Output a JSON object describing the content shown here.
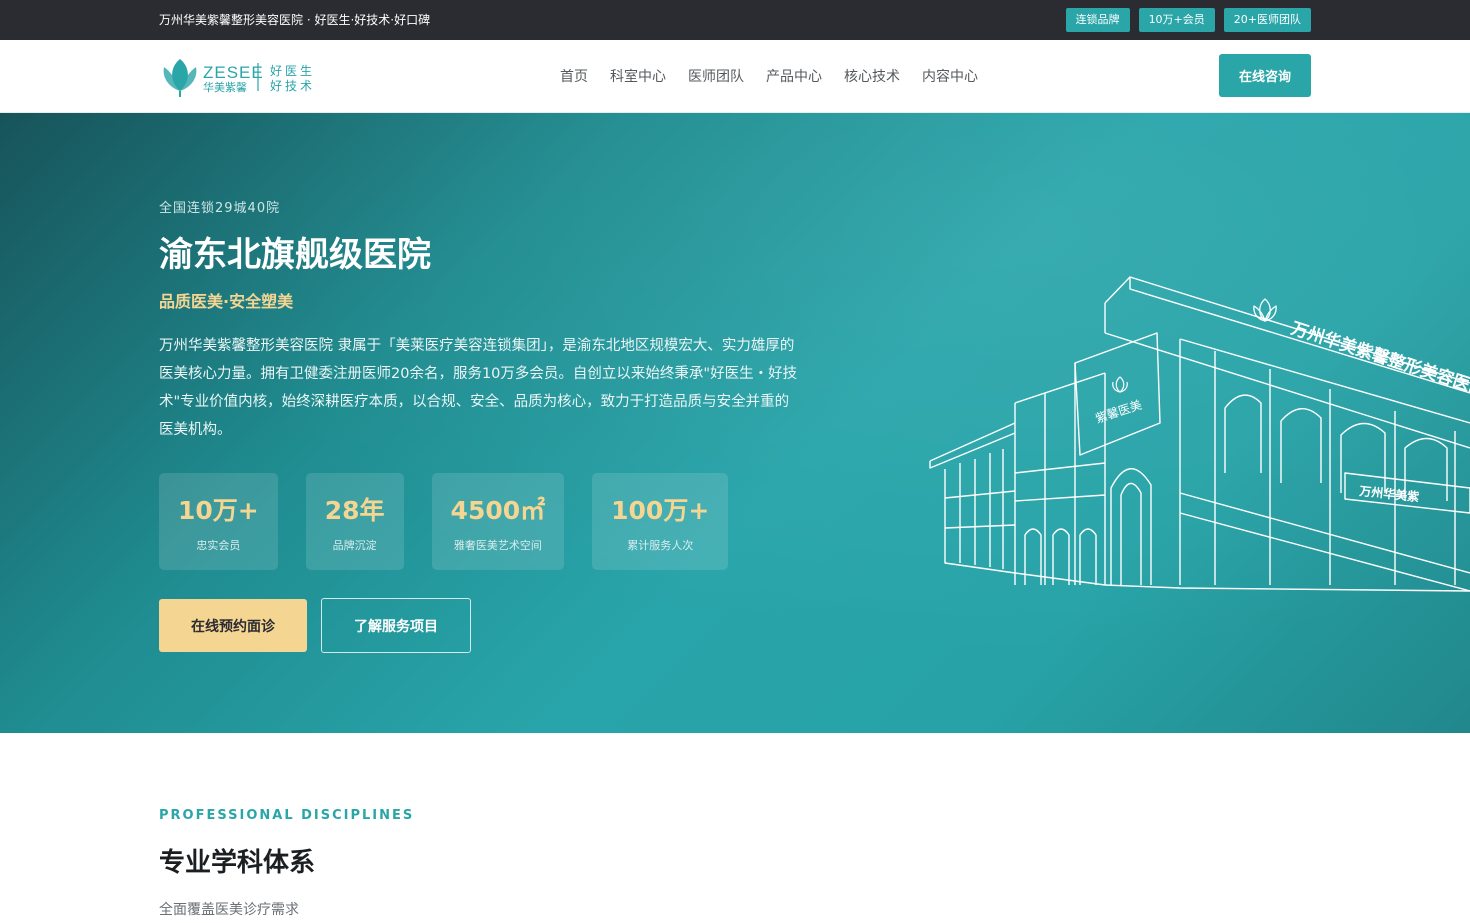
{
  "topbar": {
    "text": "万州华美紫馨整形美容医院 · 好医生·好技术·好口碑",
    "badges": [
      "连锁品牌",
      "10万+会员",
      "20+医师团队"
    ]
  },
  "logo": {
    "brand_en": "ZESEE",
    "brand_cn": "华美紫馨",
    "motto_line1": "好医生",
    "motto_line2": "好技术"
  },
  "nav": {
    "items": [
      "首页",
      "科室中心",
      "医师团队",
      "产品中心",
      "核心技术",
      "内容中心"
    ],
    "cta": "在线咨询"
  },
  "hero": {
    "kicker": "全国连锁29城40院",
    "title": "渝东北旗舰级医院",
    "slogan": "品质医美·安全塑美",
    "description": "万州华美紫馨整形美容医院 隶属于「美莱医疗美容连锁集团」，是渝东北地区规模宏大、实力雄厚的医美核心力量。拥有卫健委注册医师20余名，服务10万多会员。自创立以来始终秉承\"好医生・好技术\"专业价值内核，始终深耕医疗本质，以合规、安全、品质为核心，致力于打造品质与安全并重的医美机构。",
    "stats": [
      {
        "value": "10万+",
        "label": "忠实会员"
      },
      {
        "value": "28年",
        "label": "品牌沉淀"
      },
      {
        "value": "4500㎡",
        "label": "雅奢医美艺术空间"
      },
      {
        "value": "100万+",
        "label": "累计服务人次"
      }
    ],
    "primary_button": "在线预约面诊",
    "secondary_button": "了解服务项目",
    "building_sign_main": "万州华美紫馨整形美容医院",
    "building_sign_small": "紫馨医美",
    "building_sign_lower": "万州华美紫"
  },
  "section": {
    "kicker": "PROFESSIONAL DISCIPLINES",
    "title": "专业学科体系",
    "subtitle": "全面覆盖医美诊疗需求"
  },
  "colors": {
    "accent": "#2aa5a8",
    "gold": "#f5d592",
    "topbar": "#2a2c31"
  }
}
